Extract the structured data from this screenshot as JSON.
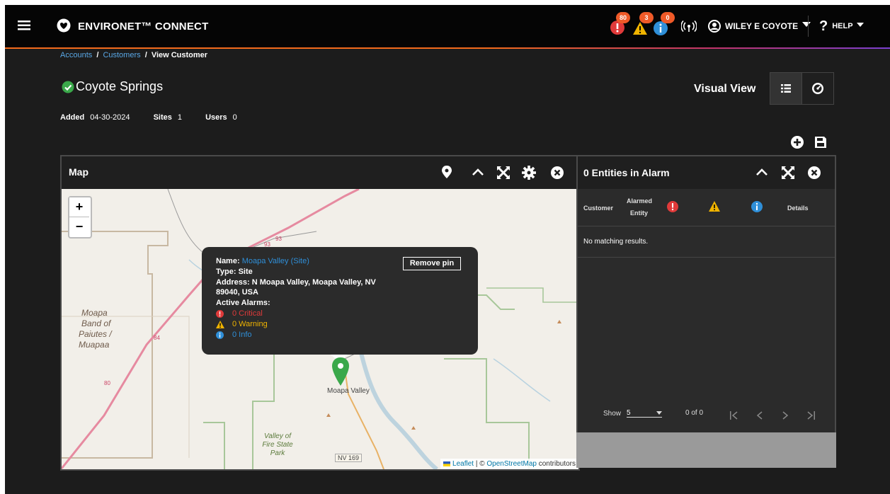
{
  "header": {
    "brand": "ENVIRONET™ CONNECT",
    "critical_count": "80",
    "warning_count": "3",
    "info_count": "0",
    "user_name": "WILEY E COYOTE",
    "help_label": "HELP"
  },
  "breadcrumb": {
    "accounts": "Accounts",
    "customers": "Customers",
    "current": "View Customer",
    "sep": "/"
  },
  "customer": {
    "name": "Coyote Springs",
    "added_label": "Added",
    "added_value": "04-30-2024",
    "sites_label": "Sites",
    "sites_value": "1",
    "users_label": "Users",
    "users_value": "0"
  },
  "view": {
    "label": "Visual View"
  },
  "map_panel": {
    "title": "Map",
    "zoom_in": "+",
    "zoom_out": "−",
    "popup": {
      "name_label": "Name:",
      "name_value": "Moapa Valley (Site)",
      "type_line": "Type: Site",
      "address_line1": "Address: N Moapa Valley, Moapa Valley, NV",
      "address_line2": "89040, USA",
      "alarms_label": "Active Alarms:",
      "critical": "0 Critical",
      "warning": "0 Warning",
      "info": "0 Info",
      "remove_pin": "Remove pin"
    },
    "labels": {
      "moapa_band_1": "Moapa",
      "moapa_band_2": "Band of",
      "moapa_band_3": "Paiutes /",
      "moapa_band_4": "Muapaa",
      "moapa_valley": "Moapa Valley",
      "park_1": "Valley of",
      "park_2": "Fire State",
      "park_3": "Park",
      "nv169": "NV 169",
      "road_93": "93",
      "road_93b": "93",
      "road_84": "84",
      "road_80": "80"
    },
    "attribution": {
      "leaflet": "Leaflet",
      "sep": "| ©",
      "osm": "OpenStreetMap",
      "contrib": "contributors"
    }
  },
  "alarm_panel": {
    "title": "0 Entities in Alarm",
    "columns": {
      "customer": "Customer",
      "alarmed_1": "Alarmed",
      "alarmed_2": "Entity",
      "details": "Details"
    },
    "empty": "No matching results.",
    "show_label": "Show",
    "show_value": "5",
    "range": "0 of 0"
  },
  "colors": {
    "accent_orange": "#f36b1c",
    "critical": "#e03a3a",
    "warning": "#f0b400",
    "info": "#2f8fd8",
    "link": "#5aa8e6",
    "ok_green": "#3aa84a"
  }
}
